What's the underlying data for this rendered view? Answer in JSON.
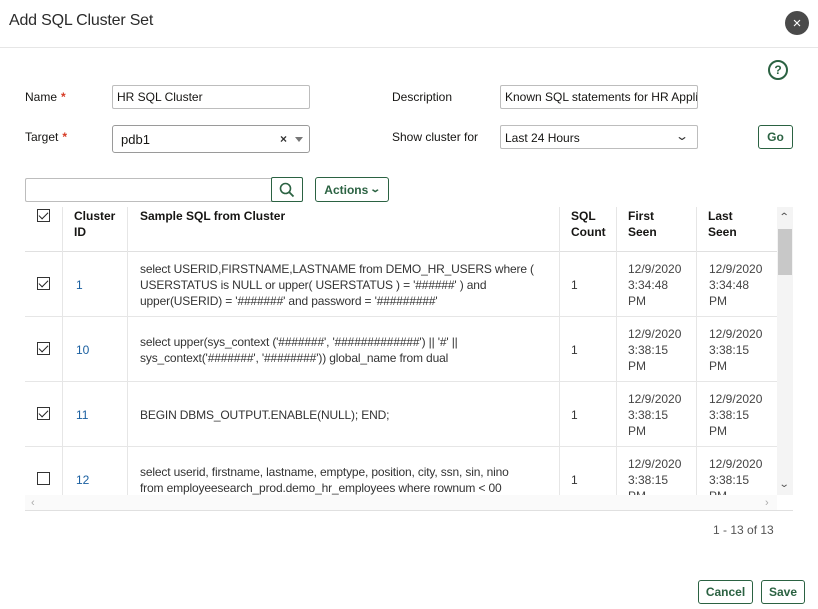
{
  "dialog": {
    "title": "Add SQL Cluster Set",
    "close_symbol": "×",
    "help_symbol": "?"
  },
  "form": {
    "name_label": "Name",
    "name_value": "HR SQL Cluster",
    "description_label": "Description",
    "description_value": "Known SQL statements for HR Application",
    "target_label": "Target",
    "target_value": "pdb1",
    "target_clear": "×",
    "show_cluster_label": "Show cluster for",
    "show_cluster_value": "Last 24 Hours",
    "go_label": "Go",
    "required_marker": "*"
  },
  "toolbar": {
    "search_value": "",
    "actions_label": "Actions"
  },
  "table": {
    "columns": [
      "Cluster ID",
      "Sample SQL from Cluster",
      "SQL Count",
      "First Seen",
      "Last Seen"
    ],
    "columns_display": {
      "cluster_id": [
        "Cluster",
        "ID"
      ],
      "sample_sql": [
        "Sample SQL from Cluster"
      ],
      "sql_count": [
        "SQL",
        "Count"
      ],
      "first_seen": [
        "First",
        "Seen"
      ],
      "last_seen": [
        "Last",
        "Seen"
      ]
    },
    "header_checkbox_checked": true,
    "rows": [
      {
        "checked": true,
        "cluster_id": "1",
        "sql_lines": [
          "select USERID,FIRSTNAME,LASTNAME from DEMO_HR_USERS where (",
          "USERSTATUS is NULL or upper( USERSTATUS ) = '######' ) and",
          "upper(USERID) = '#######' and password = '#########'"
        ],
        "sql_count": "1",
        "first_seen": [
          "12/9/2020",
          "3:34:48",
          "PM"
        ],
        "last_seen": [
          "12/9/2020",
          "3:34:48",
          "PM"
        ]
      },
      {
        "checked": true,
        "cluster_id": "10",
        "sql_lines": [
          "select upper(sys_context ('#######', '#############') || '#' ||",
          "sys_context('#######', '########')) global_name from dual"
        ],
        "sql_count": "1",
        "first_seen": [
          "12/9/2020",
          "3:38:15",
          "PM"
        ],
        "last_seen": [
          "12/9/2020",
          "3:38:15",
          "PM"
        ]
      },
      {
        "checked": true,
        "cluster_id": "11",
        "sql_lines": [
          "BEGIN DBMS_OUTPUT.ENABLE(NULL); END;"
        ],
        "sql_count": "1",
        "first_seen": [
          "12/9/2020",
          "3:38:15",
          "PM"
        ],
        "last_seen": [
          "12/9/2020",
          "3:38:15",
          "PM"
        ]
      },
      {
        "checked": false,
        "cluster_id": "12",
        "sql_lines": [
          "select userid, firstname, lastname, emptype, position, city, ssn, sin, nino",
          "from employeesearch_prod.demo_hr_employees where rownum < 00"
        ],
        "sql_count": "1",
        "first_seen": [
          "12/9/2020",
          "3:38:15",
          "PM"
        ],
        "last_seen": [
          "12/9/2020",
          "3:38:15",
          "PM"
        ]
      }
    ]
  },
  "pagination": {
    "text": "1 - 13 of 13"
  },
  "footer": {
    "cancel_label": "Cancel",
    "save_label": "Save"
  },
  "colors": {
    "accent": "#2b6242",
    "link": "#1a5fa0",
    "required": "#d63b25"
  },
  "icons": {
    "close": "close-icon",
    "help": "help-icon",
    "search": "search-icon",
    "dropdown": "chevron-down-icon"
  }
}
